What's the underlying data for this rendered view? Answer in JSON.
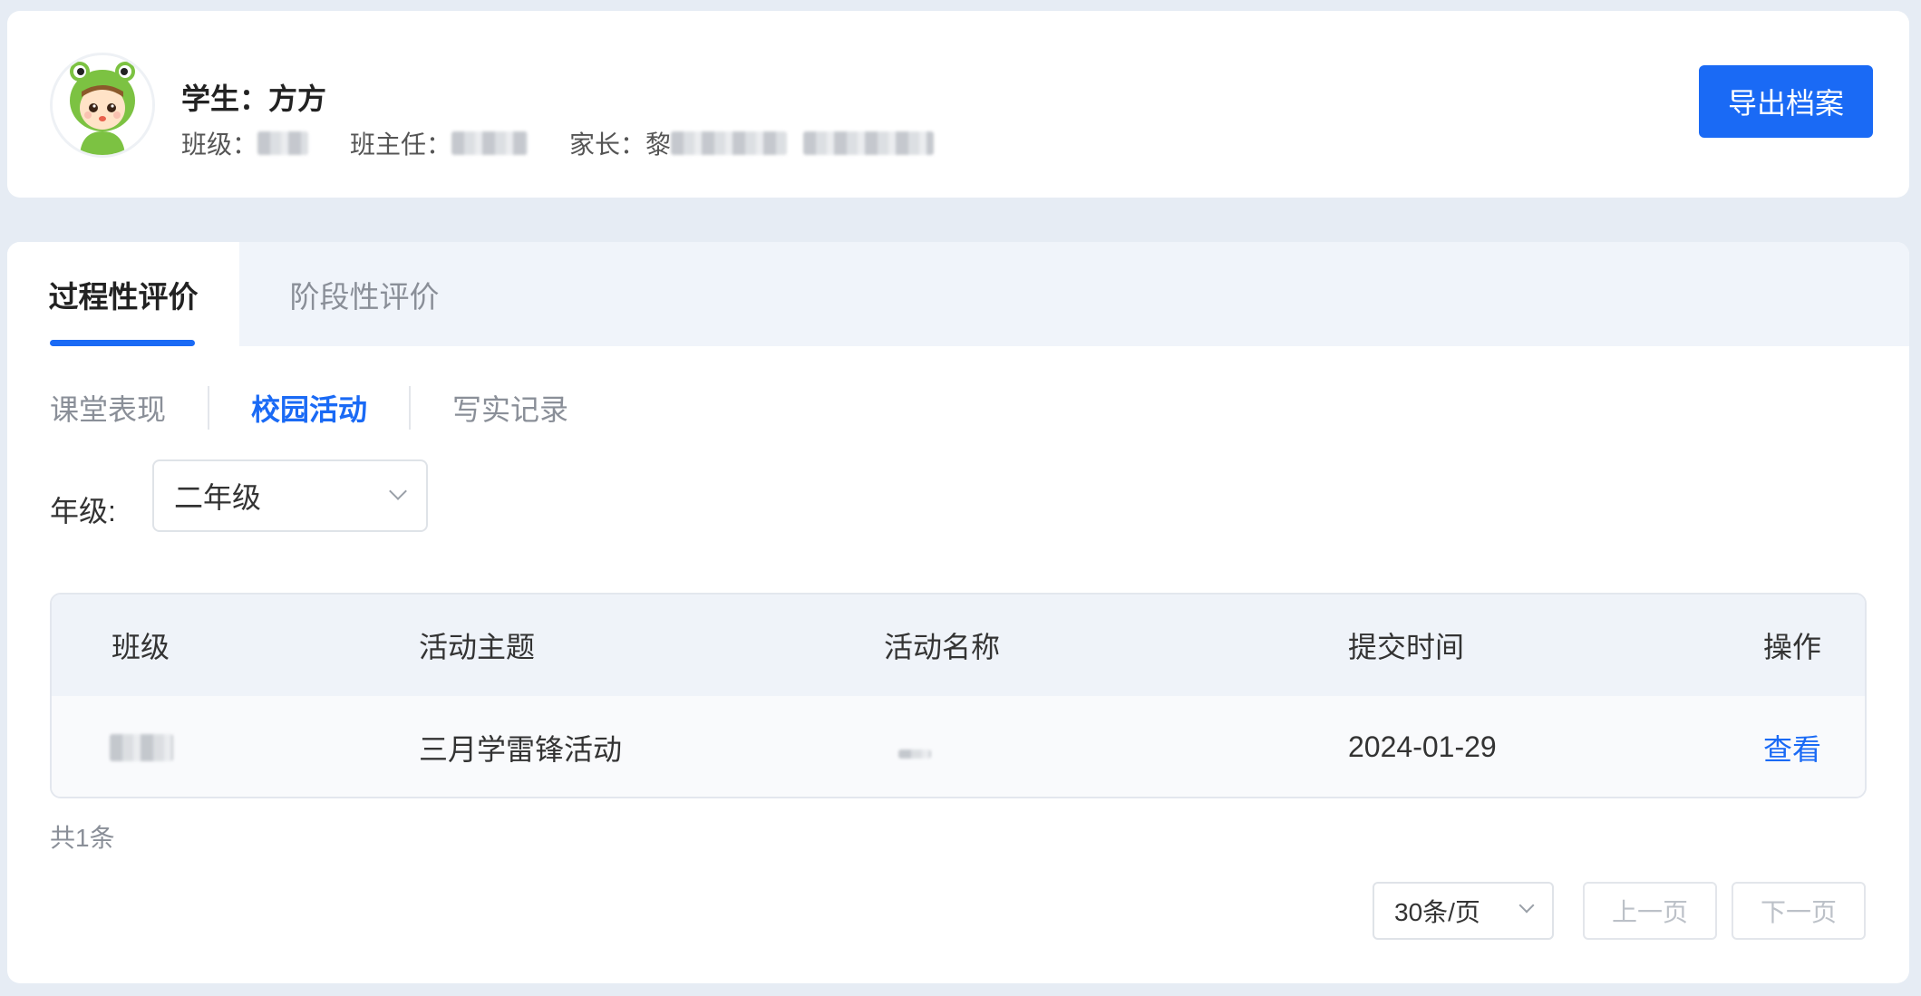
{
  "student": {
    "name_label": "学生：方方",
    "class_label": "班级：",
    "teacher_label": "班主任：",
    "parent_label": "家长：",
    "parent_first_char": "黎"
  },
  "header": {
    "export_label": "导出档案"
  },
  "tabs": [
    {
      "label": "过程性评价",
      "active": true
    },
    {
      "label": "阶段性评价",
      "active": false
    }
  ],
  "subtabs": [
    {
      "label": "课堂表现",
      "active": false
    },
    {
      "label": "校园活动",
      "active": true
    },
    {
      "label": "写实记录",
      "active": false
    }
  ],
  "filter": {
    "grade_label": "年级:",
    "grade_value": "二年级"
  },
  "table": {
    "columns": [
      "班级",
      "活动主题",
      "活动名称",
      "提交时间",
      "操作"
    ],
    "rows": [
      {
        "class": "",
        "theme": "三月学雷锋活动",
        "name": "",
        "date": "2024-01-29",
        "action": "查看"
      }
    ]
  },
  "pagination": {
    "total": "共1条",
    "page_size": "30条/页",
    "prev": "上一页",
    "next": "下一页"
  },
  "colors": {
    "accent": "#1a6af5",
    "page_bg": "#e6ecf4",
    "tabbar_bg": "#f0f4fa"
  }
}
